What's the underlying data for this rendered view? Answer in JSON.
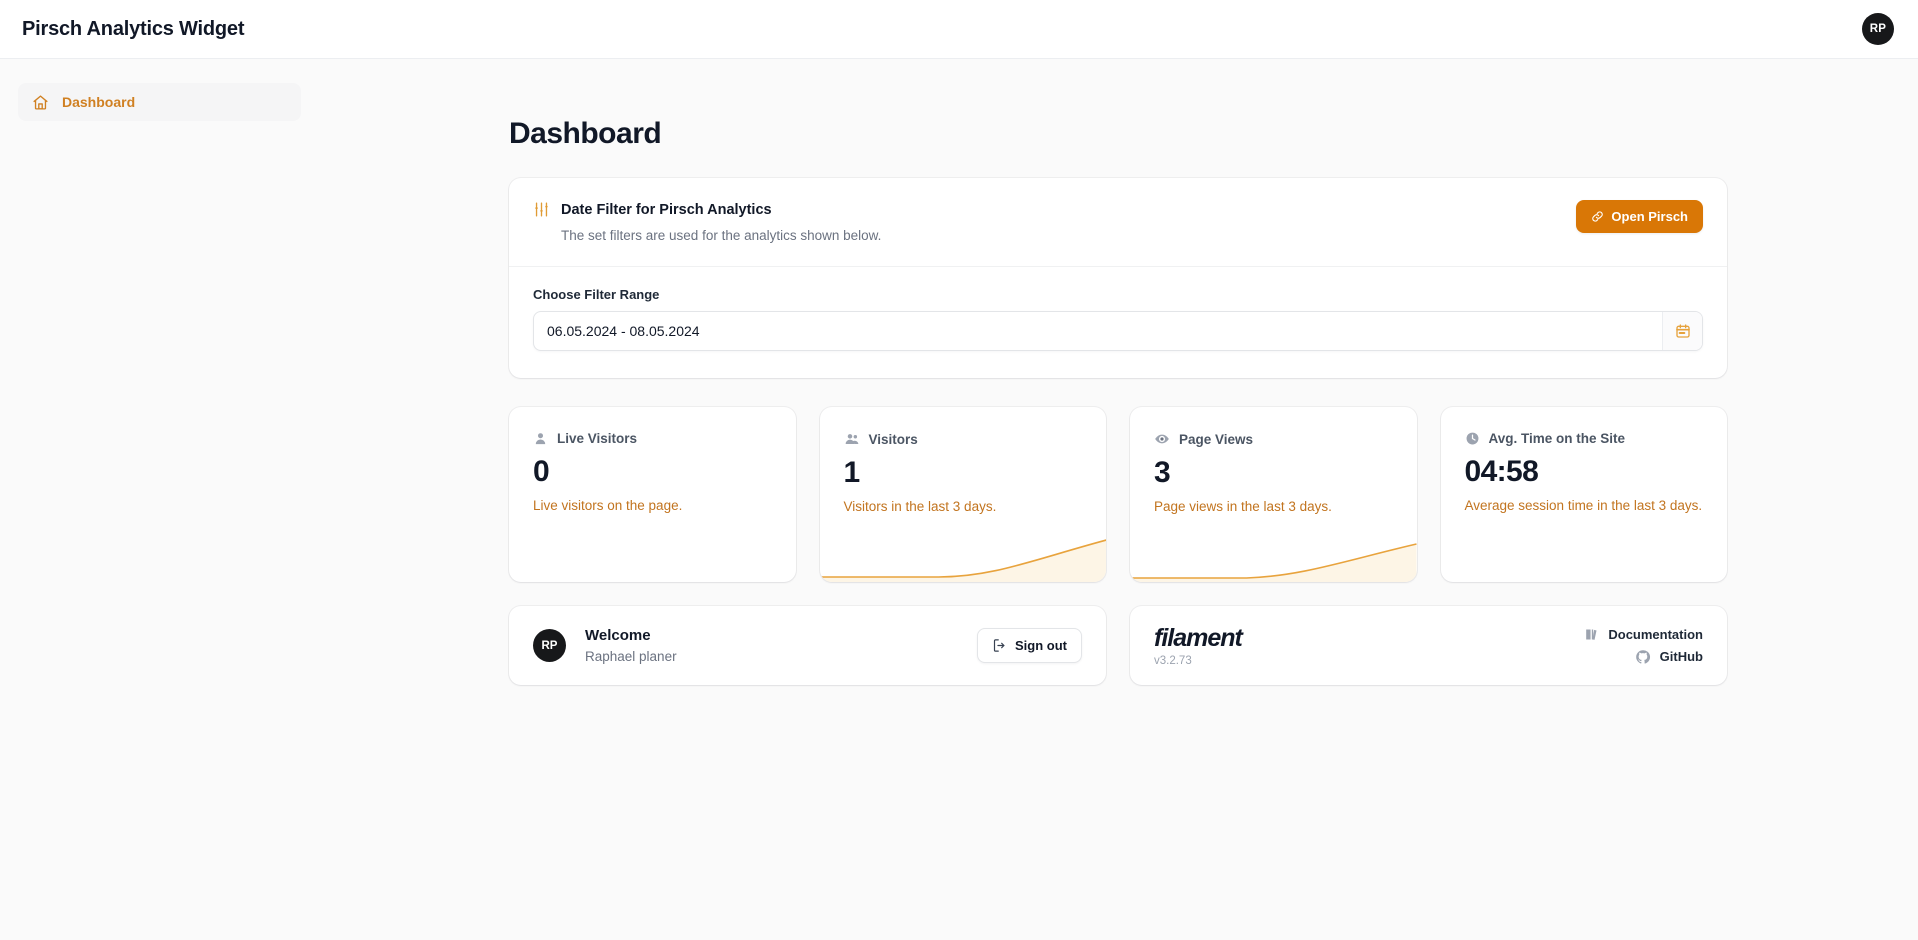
{
  "app": {
    "brand_title": "Pirsch Analytics Widget",
    "avatar_initials": "RP"
  },
  "sidebar": {
    "items": [
      {
        "label": "Dashboard",
        "icon": "home-icon",
        "active": true
      }
    ]
  },
  "main": {
    "page_title": "Dashboard"
  },
  "filter_card": {
    "icon": "adjustments-icon",
    "title": "Date Filter for Pirsch Analytics",
    "subtitle": "The set filters are used for the analytics shown below.",
    "open_button_label": "Open Pirsch",
    "open_button_icon": "link-icon",
    "field_label": "Choose Filter Range",
    "field_value": "06.05.2024 - 08.05.2024",
    "field_placeholder": "Choose Filter Range",
    "calendar_icon": "calendar-icon"
  },
  "stats": [
    {
      "icon": "user-icon",
      "label": "Live Visitors",
      "value": "0",
      "description": "Live visitors on the page.",
      "has_chart": false
    },
    {
      "icon": "users-icon",
      "label": "Visitors",
      "value": "1",
      "description": "Visitors in the last 3 days.",
      "has_chart": true
    },
    {
      "icon": "eye-icon",
      "label": "Page Views",
      "value": "3",
      "description": "Page views in the last 3 days.",
      "has_chart": true
    },
    {
      "icon": "clock-icon",
      "label": "Avg. Time on the Site",
      "value": "04:58",
      "description": "Average session time in the last 3 days.",
      "has_chart": false
    }
  ],
  "user_card": {
    "avatar_initials": "RP",
    "welcome_title": "Welcome",
    "user_name": "Raphael planer",
    "sign_out_label": "Sign out",
    "sign_out_icon": "logout-icon"
  },
  "footer_card": {
    "logo_text": "filament",
    "version": "v3.2.73",
    "links": [
      {
        "label": "Documentation",
        "icon": "book-icon"
      },
      {
        "label": "GitHub",
        "icon": "github-icon"
      }
    ]
  },
  "colors": {
    "accent": "#d97706",
    "accent_text": "#c2741f",
    "sidebar_active_text": "#d08022",
    "page_bg": "#fafafa",
    "card_bg": "#ffffff"
  },
  "chart_data": [
    {
      "type": "area",
      "title": "Visitors sparkline",
      "x": [
        0,
        1,
        2
      ],
      "values": [
        0,
        0,
        1
      ],
      "ylim": [
        0,
        1
      ],
      "color": "#e8a33d",
      "grid": false,
      "legend": false
    },
    {
      "type": "area",
      "title": "Page Views sparkline",
      "x": [
        0,
        1,
        2
      ],
      "values": [
        0,
        0,
        3
      ],
      "ylim": [
        0,
        3
      ],
      "color": "#e8a33d",
      "grid": false,
      "legend": false
    }
  ]
}
